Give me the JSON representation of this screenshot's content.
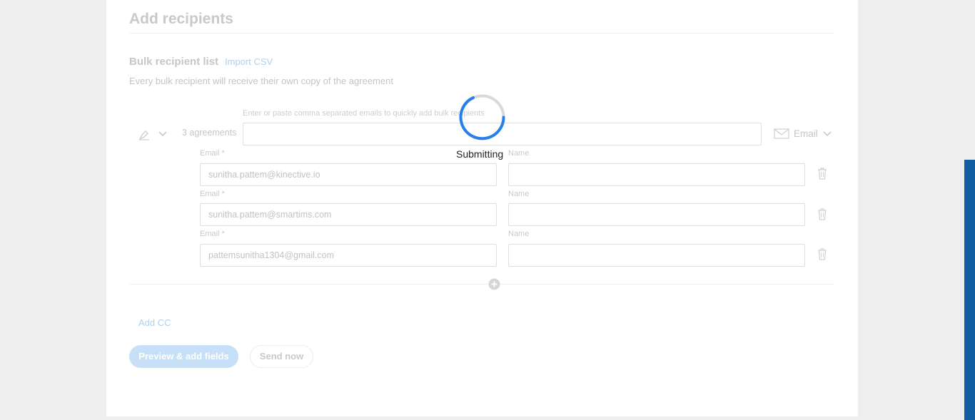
{
  "page": {
    "title": "Add recipients",
    "bulk_label": "Bulk recipient list",
    "import_link": "Import CSV",
    "bulk_description": "Every bulk recipient will receive their own copy of the agreement"
  },
  "bulk_row": {
    "agreements": "3 agreements",
    "hint": "Enter or paste comma separated emails to quickly add bulk recipients",
    "delivery_method": "Email",
    "icons": {
      "signer": "pen-icon",
      "dropdown": "chevron-down-icon",
      "delivery": "mail-icon"
    }
  },
  "recipients": [
    {
      "email_label": "Email",
      "required_mark": "*",
      "email": "sunitha.pattem@kinective.io",
      "name_label": "Name",
      "name": ""
    },
    {
      "email_label": "Email",
      "required_mark": "*",
      "email": "sunitha.pattem@smartims.com",
      "name_label": "Name",
      "name": ""
    },
    {
      "email_label": "Email",
      "required_mark": "*",
      "email": "pattemsunitha1304@gmail.com",
      "name_label": "Name",
      "name": ""
    }
  ],
  "actions": {
    "add_cc": "Add CC",
    "preview": "Preview & add fields",
    "send_now": "Send now"
  },
  "overlay": {
    "status": "Submitting"
  },
  "colors": {
    "accent": "#2680eb",
    "link": "#b3cfea",
    "primary_button": "#c7dff7",
    "side_strip": "#0f5ca3"
  }
}
